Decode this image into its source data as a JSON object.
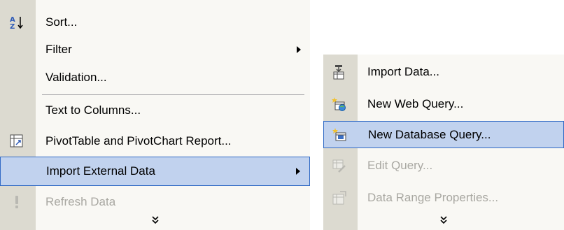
{
  "main_menu": {
    "items": [
      {
        "id": "sort",
        "label": "Sort...",
        "icon": "sort-az-icon",
        "enabled": true,
        "submenu": false
      },
      {
        "id": "filter",
        "label": "Filter",
        "icon": "",
        "enabled": true,
        "submenu": true
      },
      {
        "id": "validation",
        "label": "Validation...",
        "icon": "",
        "enabled": true,
        "submenu": false
      },
      {
        "id": "text-to-columns",
        "label": "Text to Columns...",
        "icon": "",
        "enabled": true,
        "submenu": false
      },
      {
        "id": "pivottable",
        "label": "PivotTable and PivotChart Report...",
        "icon": "pivottable-icon",
        "enabled": true,
        "submenu": false
      },
      {
        "id": "import-external-data",
        "label": "Import External Data",
        "icon": "",
        "enabled": true,
        "submenu": true,
        "highlighted": true
      },
      {
        "id": "refresh-data",
        "label": "Refresh Data",
        "icon": "refresh-exclamation-icon",
        "enabled": false,
        "submenu": false
      }
    ],
    "expand_glyph": "»"
  },
  "sub_menu": {
    "items": [
      {
        "id": "import-data",
        "label": "Import Data...",
        "icon": "import-data-icon",
        "enabled": true
      },
      {
        "id": "new-web-query",
        "label": "New Web Query...",
        "icon": "web-query-icon",
        "enabled": true
      },
      {
        "id": "new-database-query",
        "label": "New Database Query...",
        "icon": "database-query-icon",
        "enabled": true,
        "highlighted": true
      },
      {
        "id": "edit-query",
        "label": "Edit Query...",
        "icon": "edit-query-icon",
        "enabled": false
      },
      {
        "id": "data-range-properties",
        "label": "Data Range Properties...",
        "icon": "data-range-properties-icon",
        "enabled": false
      }
    ],
    "expand_glyph": "»"
  },
  "colors": {
    "menu_bg": "#f9f8f4",
    "gutter": "#dcdad0",
    "highlight_bg": "#c1d2ee",
    "highlight_border": "#316ac5",
    "disabled_text": "#a9a8a2"
  }
}
